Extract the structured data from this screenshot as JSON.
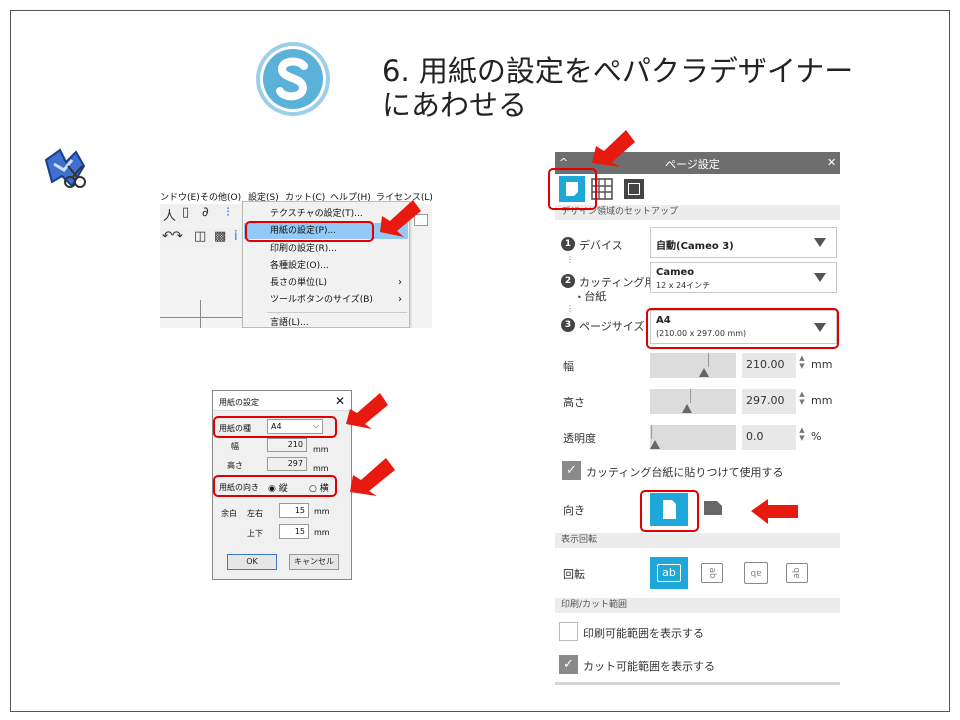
{
  "slide": {
    "title_line1": "6. 用紙の設定をぺパクラデザイナー",
    "title_line2": "にあわせる"
  },
  "menu_screenshot": {
    "menubar": [
      "ンドウ(E)",
      "その他(O)",
      "設定(S)",
      "カット(C)",
      "ヘルプ(H)",
      "ライセンス(L)"
    ],
    "items": [
      {
        "label": "テクスチャの設定(T)...",
        "highlighted": false,
        "submenu": false
      },
      {
        "label": "用紙の設定(P)...",
        "highlighted": true,
        "submenu": false
      },
      {
        "label": "印刷の設定(R)...",
        "highlighted": false,
        "submenu": false
      },
      {
        "label": "各種設定(O)...",
        "highlighted": false,
        "submenu": false
      },
      {
        "label": "長さの単位(L)",
        "highlighted": false,
        "submenu": true
      },
      {
        "label": "ツールボタンのサイズ(B)",
        "highlighted": false,
        "submenu": true
      },
      {
        "label": "言語(L)...",
        "highlighted": false,
        "submenu": false
      }
    ]
  },
  "paper_dialog": {
    "title": "用紙の設定",
    "close": "✕",
    "paper_type_label": "用紙の種",
    "paper_type_value": "A4",
    "width_label": "幅",
    "width_value": "210",
    "height_label": "高さ",
    "height_value": "297",
    "unit_mm": "mm",
    "orientation_label": "用紙の向き",
    "orientation_portrait": "縦",
    "orientation_landscape": "横",
    "orientation_selected": "縦",
    "margin_label": "余白",
    "margin_lr_label": "左右",
    "margin_lr_value": "15",
    "margin_tb_label": "上下",
    "margin_tb_value": "15",
    "ok_label": "OK",
    "cancel_label": "キャンセル"
  },
  "page_settings": {
    "panel_title": "ページ設定",
    "close": "✕",
    "collapse": "^",
    "section_design": "デザイン領域のセットアップ",
    "device_label": "デバイス",
    "device_value": "自動(Cameo 3)",
    "mat_label_1": "カッティング用",
    "mat_label_2": "台紙",
    "mat_value": "Cameo",
    "mat_sub": "12 x 24インチ",
    "page_size_label": "ページサイズ",
    "page_size_value": "A4",
    "page_size_sub": "(210.00 x 297.00 mm)",
    "width_label": "幅",
    "width_value": "210.00",
    "height_label": "高さ",
    "height_value": "297.00",
    "opacity_label": "透明度",
    "opacity_value": "0.0",
    "unit_mm": "mm",
    "unit_pct": "%",
    "use_mat_label": "カッティング台紙に貼りつけて使用する",
    "use_mat_checked": true,
    "orientation_label": "向き",
    "section_rotate": "表示回転",
    "rotate_label": "回転",
    "rotate_options": [
      "ab",
      "ab",
      "ab",
      "ab"
    ],
    "section_print_cut": "印刷/カット範囲",
    "show_print_label": "印刷可能範囲を表示する",
    "show_print_checked": false,
    "show_cut_label": "カット可能範囲を表示する",
    "show_cut_checked": true,
    "accent_color": "#1ea7d8"
  },
  "annotation_color": "#e8190f"
}
